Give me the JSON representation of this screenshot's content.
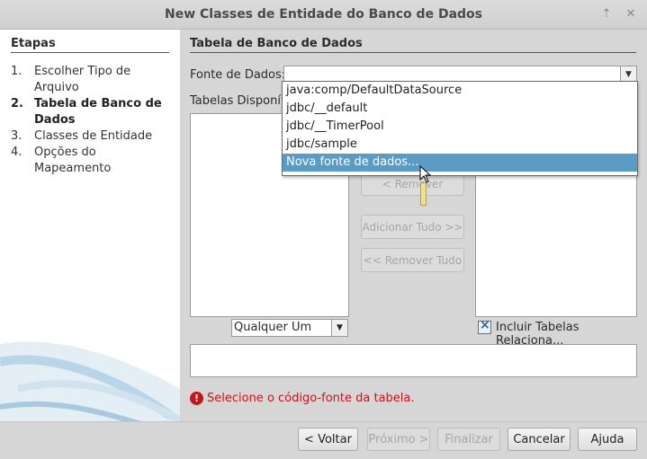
{
  "window": {
    "title": "New Classes de Entidade do Banco de Dados"
  },
  "steps": {
    "heading": "Etapas",
    "items": [
      {
        "num": "1.",
        "label": "Escolher Tipo de Arquivo"
      },
      {
        "num": "2.",
        "label": "Tabela de Banco de Dados"
      },
      {
        "num": "3.",
        "label": "Classes de Entidade"
      },
      {
        "num": "4.",
        "label": "Opções do Mapeamento"
      }
    ]
  },
  "main": {
    "title": "Tabela de Banco de Dados",
    "datasource_label": "Fonte de Dados:",
    "datasource_value": "",
    "available_tables_label": "Tabelas Disponíveis:",
    "datasource_options": [
      "java:comp/DefaultDataSource",
      "jdbc/__default",
      "jdbc/__TimerPool",
      "jdbc/sample",
      "Nova fonte de dados..."
    ],
    "selected_option": "Nova fonte de dados...",
    "remove_button": "< Remover",
    "add_all_button": "Adicionar Tudo >>",
    "remove_all_button": "<< Remover Tudo",
    "filter_value": "Qualquer Um",
    "include_related_label": "Incluir Tabelas Relaciona...",
    "include_related_checked": true,
    "error_message": "Selecione o código-fonte da tabela."
  },
  "footer": {
    "back": "< Voltar",
    "next": "Próximo >",
    "finish": "Finalizar",
    "cancel": "Cancelar",
    "help": "Ajuda"
  },
  "colors": {
    "selection": "#5b9bc4",
    "error": "#c8141e"
  }
}
